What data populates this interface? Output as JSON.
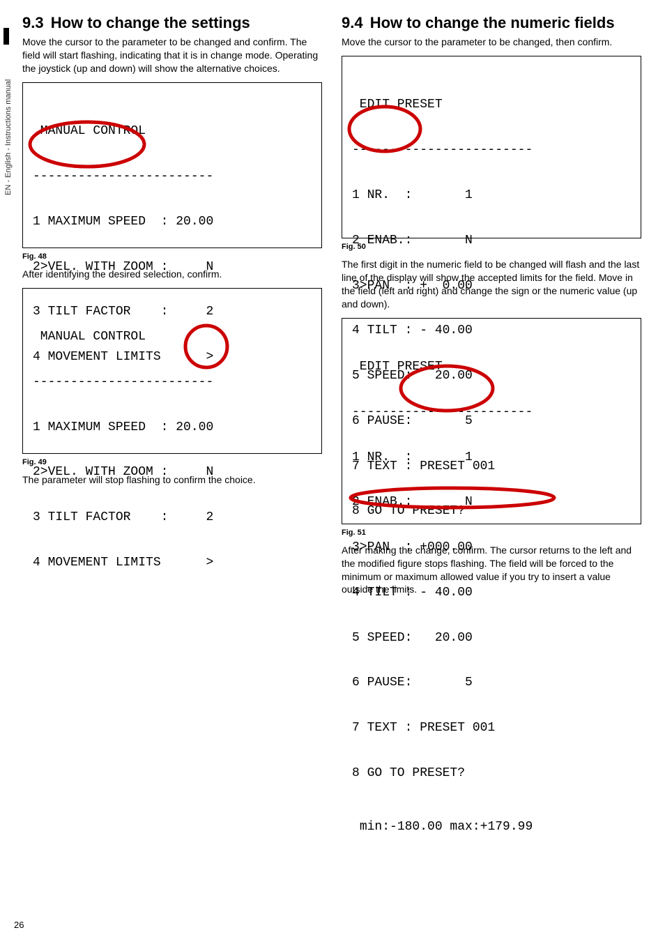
{
  "side": {
    "label": "EN - English - Instructions manual"
  },
  "page_number": "26",
  "left": {
    "heading_num": "9.3",
    "heading_text": "How to change the settings",
    "intro": "Move the cursor to the parameter to be changed and confirm. The field will start flashing, indicating that it is in change mode. Operating the joystick (up and down) will show the alternative choices.",
    "term1": {
      "title": " MANUAL CONTROL",
      "sep": "------------------------",
      "l1": "1 MAXIMUM SPEED  : 20.00",
      "l2": "2>VEL. WITH ZOOM :     N",
      "l3": "3 TILT FACTOR    :     2",
      "l4": "4 MOVEMENT LIMITS      >"
    },
    "fig1": "Fig. 48",
    "mid": "After identifying the desired selection, confirm.",
    "term2": {
      "title": " MANUAL CONTROL",
      "sep": "------------------------",
      "l1": "1 MAXIMUM SPEED  : 20.00",
      "l2": "2>VEL. WITH ZOOM :     N",
      "l3": "3 TILT FACTOR    :     2",
      "l4": "4 MOVEMENT LIMITS      >"
    },
    "fig2": "Fig. 49",
    "after": "The parameter will stop flashing to confirm the choice."
  },
  "right": {
    "heading_num": "9.4",
    "heading_text": "How to change the numeric fields",
    "intro": "Move the cursor to the parameter to be changed, then confirm.",
    "term1": {
      "title": " EDIT PRESET",
      "sep": "------------------------",
      "l1": "1 NR.  :       1",
      "l2": "2 ENAB.:       N",
      "l3": "3>PAN  : +  0.00",
      "l4": "4 TILT : - 40.00",
      "l5": "5 SPEED:   20.00",
      "l6": "6 PAUSE:       5",
      "l7": "7 TEXT : PRESET 001",
      "l8": "8 GO TO PRESET?"
    },
    "fig1": "Fig. 50",
    "mid": "The first digit in the numeric field to be changed will flash and the last line of the display will show the accepted limits for the field. Move in the field (left and right) and change the sign or the numeric value (up and down).",
    "term2": {
      "title": " EDIT PRESET",
      "sep": "------------------------",
      "l1": "1 NR.  :       1",
      "l2": "2 ENAB.:       N",
      "l3": "3>PAN  : +000.00",
      "l4": "4 TILT : - 40.00",
      "l5": "5 SPEED:   20.00",
      "l6": "6 PAUSE:       5",
      "l7": "7 TEXT : PRESET 001",
      "l8": "8 GO TO PRESET?",
      "footer": "min:-180.00 max:+179.99"
    },
    "fig2": "Fig. 51",
    "after": "After making the change, confirm. The cursor returns to the left and the modified figure stops flashing. The field will be forced to the minimum or maximum allowed value if you try to insert a value outside the limits."
  }
}
